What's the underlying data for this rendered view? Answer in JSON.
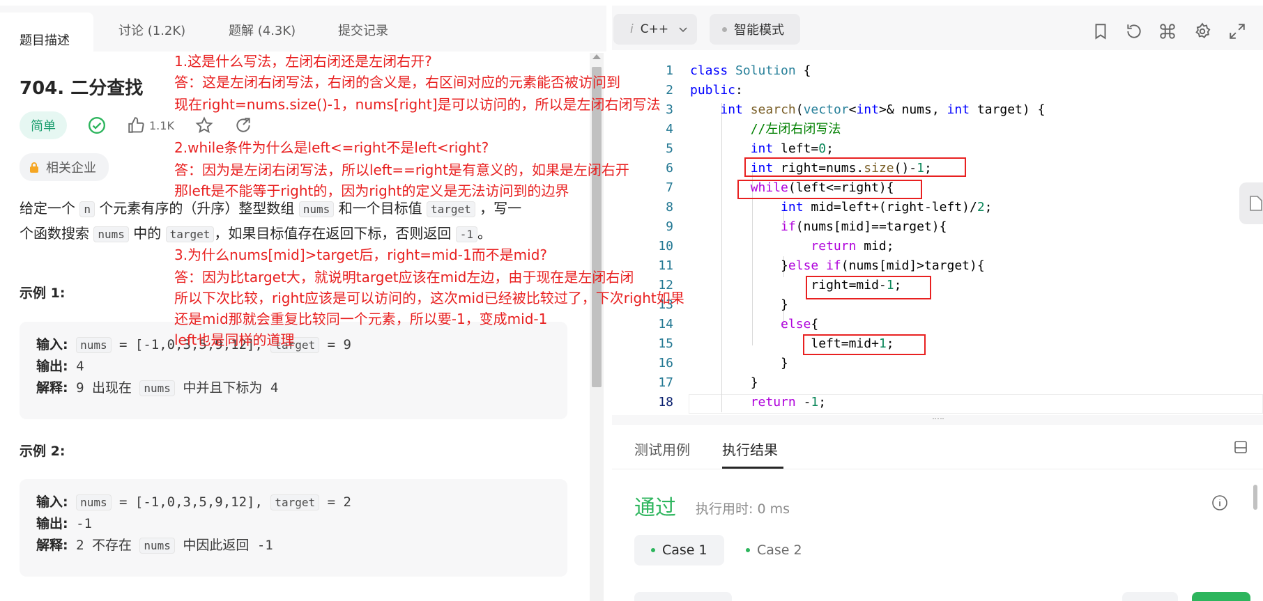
{
  "left_tabs": [
    "题目描述",
    "讨论 (1.2K)",
    "题解 (4.3K)",
    "提交记录"
  ],
  "problem": {
    "title": "704. 二分查找",
    "difficulty": "简单",
    "likes": "1.1K",
    "company_tag": "相关企业",
    "desc_line1_a": "给定一个",
    "desc_n": "n",
    "desc_line1_b": "个元素有序的（升序）整型数组",
    "desc_nums": "nums",
    "desc_line1_c": "和一个目标值",
    "desc_target": "target",
    "desc_line1_d": "，写一",
    "desc_line2_a": "个函数搜索",
    "desc_nums2": "nums",
    "desc_line2_b": "中的",
    "desc_target2": "target",
    "desc_line2_c": "，如果目标值存在返回下标，否则返回",
    "desc_minus1": "-1",
    "desc_line2_d": "。"
  },
  "examples": [
    {
      "title": "示例 1:",
      "input_label": "输入:",
      "input_nums_chip": "nums",
      "input_nums_val": " = [-1,0,3,5,9,12], ",
      "input_target_chip": "target",
      "input_target_val": " = 9",
      "output_label": "输出:",
      "output_val": "4",
      "explain_label": "解释:",
      "explain_a": "9 出现在",
      "explain_chip": "nums",
      "explain_b": "中并且下标为 4"
    },
    {
      "title": "示例 2:",
      "input_label": "输入:",
      "input_nums_chip": "nums",
      "input_nums_val": " = [-1,0,3,5,9,12], ",
      "input_target_chip": "target",
      "input_target_val": " = 2",
      "output_label": "输出:",
      "output_val": "-1",
      "explain_label": "解释:",
      "explain_a": "2 不存在",
      "explain_chip": "nums",
      "explain_b": "中因此返回 -1"
    }
  ],
  "annotations": [
    "1.这是什么写法，左闭右闭还是左闭右开?",
    "答：这是左闭右闭写法，右闭的含义是，右区间对应的元素能否被访问到",
    "现在right=nums.size()-1，nums[right]是可以访问的，所以是左闭右闭写法",
    "2.while条件为什么是left<=right不是left<right?",
    "答：因为是左闭右闭写法，所以left==right是有意义的，如果是左闭右开",
    "那left是不能等于right的，因为right的定义是无法访问到的边界",
    "3.为什么nums[mid]>target后，right=mid-1而不是mid?",
    "答：因为比target大，就说明target应该在mid左边，由于现在是左闭右闭",
    "所以下次比较，right应该是可以访问的，这次mid已经被比较过了，下次right如果",
    "还是mid那就会重复比较同一个元素，所以要-1，变成mid-1",
    "left也是同样的道理"
  ],
  "editor": {
    "language": "C++",
    "mode": "智能模式",
    "line_numbers": [
      "1",
      "2",
      "3",
      "4",
      "5",
      "6",
      "7",
      "8",
      "9",
      "10",
      "11",
      "12",
      "13",
      "14",
      "15",
      "16",
      "17",
      "18"
    ],
    "lines": [
      "class Solution {",
      "public:",
      "    int search(vector<int>& nums, int target) {",
      "        //左闭右闭写法",
      "        int left=0;",
      "        int right=nums.size()-1;",
      "        while(left<=right){",
      "            int mid=left+(right-left)/2;",
      "            if(nums[mid]==target){",
      "                return mid;",
      "            }else if(nums[mid]>target){",
      "                right=mid-1;",
      "            }",
      "            else{",
      "                left=mid+1;",
      "            }",
      "        }",
      "        return -1;"
    ]
  },
  "bottom": {
    "tabs": [
      "测试用例",
      "执行结果"
    ],
    "status": "通过",
    "runtime": "执行用时: 0 ms",
    "cases": [
      "Case 1",
      "Case 2"
    ]
  },
  "colors": {
    "annotation_red": "#e82020",
    "pass_green": "#2db55d",
    "easy_green": "#1a9e6e"
  }
}
